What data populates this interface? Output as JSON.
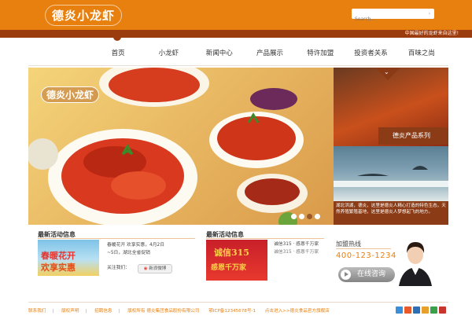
{
  "header": {
    "logo": "德炎小龙虾",
    "search_placeholder": "Search...",
    "slogan": "中国最好的龙虾来自这里!"
  },
  "nav": {
    "items": [
      "首页",
      "小龙虾",
      "新闻中心",
      "产品展示",
      "特许加盟",
      "投资者关系",
      "百味之尚"
    ]
  },
  "banner": {
    "logo": "德炎小龙虾",
    "dots": 4,
    "active_dot": 3
  },
  "right_panel": {
    "label": "德炎产品系列",
    "arrow": "⌄",
    "text": "湖北洪湖，德炎，这里是德炎人精心打造的特色生态，天然养殖繁殖基地，这里是德炎人梦想起飞的地方。"
  },
  "news1": {
    "title": "最新活动信息",
    "image_text_1": "春暖花开",
    "image_text_2": "欢享实惠",
    "line1": "春暖花开 欢享实惠，4月2日",
    "line2": "~5日，湖北全省促销",
    "share_label": "关注我们：",
    "share_button": "新浪微博"
  },
  "news2": {
    "title": "最新活动信息",
    "image_text_1": "诚信315",
    "image_text_2": "感恩千万家",
    "headline": "诚信315 · 感恩千万家",
    "body": "诚信315 · 感恩千万家"
  },
  "hotline": {
    "title": "加盟热线",
    "number": "400-123-1234",
    "consult": "在线咨询"
  },
  "footer": {
    "links": [
      "联系我们",
      "版权声明",
      "招聘信息"
    ],
    "copyright": "版权所有 德炎集团食品股份有限公司",
    "icp": "鄂ICP备12345678号-1",
    "note": "点击进入>>德炎食品官方旗舰店"
  },
  "colors": {
    "brand_orange": "#e8800f",
    "dark_brown": "#8b3b15",
    "footer_text": "#e8800f"
  },
  "icons": [
    "search-icon",
    "play-icon",
    "weibo-icon",
    "share-icons"
  ]
}
